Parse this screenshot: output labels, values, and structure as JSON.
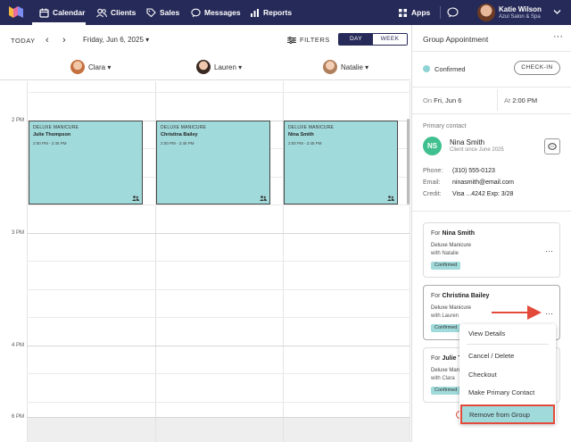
{
  "nav": {
    "items": [
      {
        "label": "Calendar",
        "icon": "calendar-icon"
      },
      {
        "label": "Clients",
        "icon": "users-icon"
      },
      {
        "label": "Sales",
        "icon": "tag-icon"
      },
      {
        "label": "Messages",
        "icon": "chat-icon"
      },
      {
        "label": "Reports",
        "icon": "bar-chart-icon"
      }
    ],
    "apps_label": "Apps",
    "user_name": "Katie Wilson",
    "user_business": "Azul Salon & Spa"
  },
  "calendar": {
    "today_label": "TODAY",
    "date_label": "Friday, Jun 6, 2025 ▾",
    "filters_label": "FILTERS",
    "view_day": "DAY",
    "view_week": "WEEK",
    "staff": [
      {
        "name": "Clara ▾",
        "color": "#c4703f"
      },
      {
        "name": "Lauren ▾",
        "color": "#3a2a22"
      },
      {
        "name": "Natalie ▾",
        "color": "#b07f5c"
      }
    ],
    "hours": [
      "2 PM",
      "3 PM",
      "4 PM",
      "6 PM"
    ],
    "appointments": [
      {
        "service": "DELUXE MANICURE",
        "client": "Julie Thompson",
        "time": "2:00 PM - 2:45 PM"
      },
      {
        "service": "DELUXE MANICURE",
        "client": "Christina Bailey",
        "time": "2:00 PM - 2:45 PM"
      },
      {
        "service": "DELUXE MANICURE",
        "client": "Nina Smith",
        "time": "2:00 PM - 2:45 PM"
      }
    ]
  },
  "panel": {
    "title": "Group Appointment",
    "status": "Confirmed",
    "checkin_label": "CHECK-IN",
    "on_prefix": "On",
    "on_date": "Fri, Jun 6",
    "at_prefix": "At",
    "at_time": "2:00 PM",
    "primary_contact_label": "Primary contact",
    "contact": {
      "initials": "NS",
      "name": "Nina Smith",
      "since": "Client since June 2025",
      "phone_label": "Phone:",
      "phone": "(310) 555-0123",
      "email_label": "Email:",
      "email": "ninasmith@email.com",
      "credit_label": "Credit:",
      "credit": "Visa   ...4242   Exp: 3/28"
    },
    "cards": [
      {
        "for": "For",
        "name": "Nina Smith",
        "service": "Deluxe Manicure",
        "with": "with Natalie",
        "status": "Confirmed"
      },
      {
        "for": "For",
        "name": "Christina Bailey",
        "service": "Deluxe Manicure",
        "with": "with Lauren",
        "status": "Confirmed"
      },
      {
        "for": "For",
        "name": "Julie Th",
        "service": "Deluxe Mani",
        "with": "with Clara",
        "status": "Confirmed"
      }
    ]
  },
  "context_menu": {
    "items": [
      "View Details",
      "Cancel / Delete",
      "Checkout",
      "Make Primary Contact",
      "Remove from Group"
    ]
  },
  "colors": {
    "nav_bg": "#262a58",
    "appointment": "#a1dadb",
    "highlight_border": "#e34a3a",
    "avatar_green": "#3fc08e"
  }
}
